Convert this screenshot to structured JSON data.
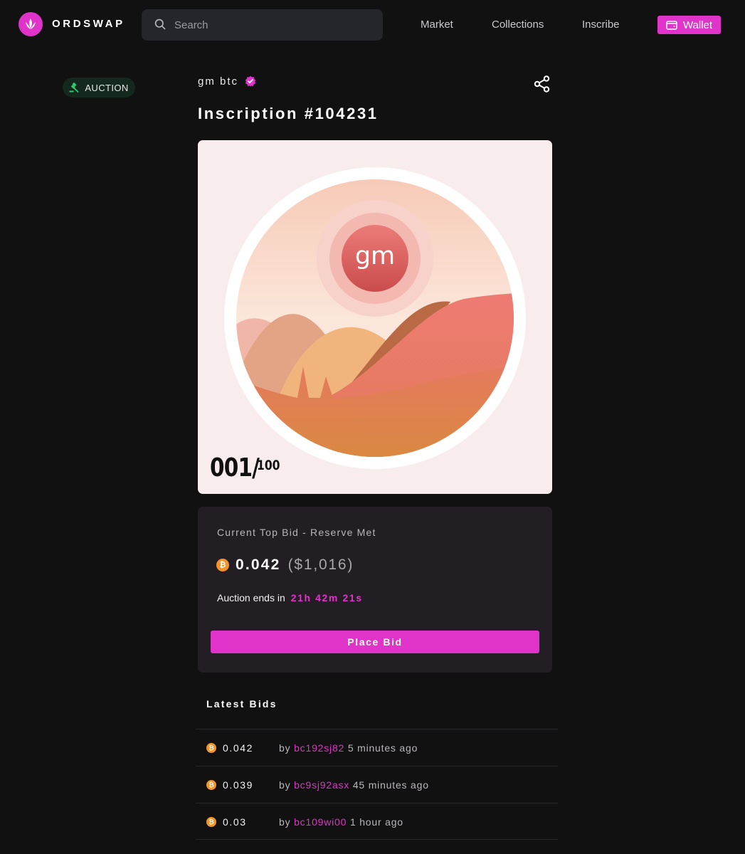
{
  "header": {
    "brand": "ORDSWAP",
    "search_placeholder": "Search",
    "nav": [
      "Market",
      "Collections",
      "Inscribe"
    ],
    "wallet_label": "Wallet",
    "accent": "#e033c9"
  },
  "badge": {
    "label": "AUCTION",
    "icon": "gavel-icon"
  },
  "collection": {
    "name": "gm btc",
    "verified": true
  },
  "inscription": {
    "title": "Inscription #104231"
  },
  "artwork": {
    "text": "gm",
    "edition": "001/",
    "edition_total": "100"
  },
  "bid": {
    "label": "Current Top Bid - Reserve Met",
    "amount": "0.042",
    "usd": "($1,016)",
    "ends_label": "Auction ends in",
    "countdown": "21h 42m 21s",
    "button": "Place Bid"
  },
  "latest_bids": {
    "title": "Latest Bids",
    "by_label": "by",
    "rows": [
      {
        "amount": "0.042",
        "address": "bc192sj82",
        "time": "5 minutes ago"
      },
      {
        "amount": "0.039",
        "address": "bc9sj92asx",
        "time": "45 minutes ago"
      },
      {
        "amount": "0.03",
        "address": "bc109wi00",
        "time": "1 hour ago"
      }
    ]
  }
}
